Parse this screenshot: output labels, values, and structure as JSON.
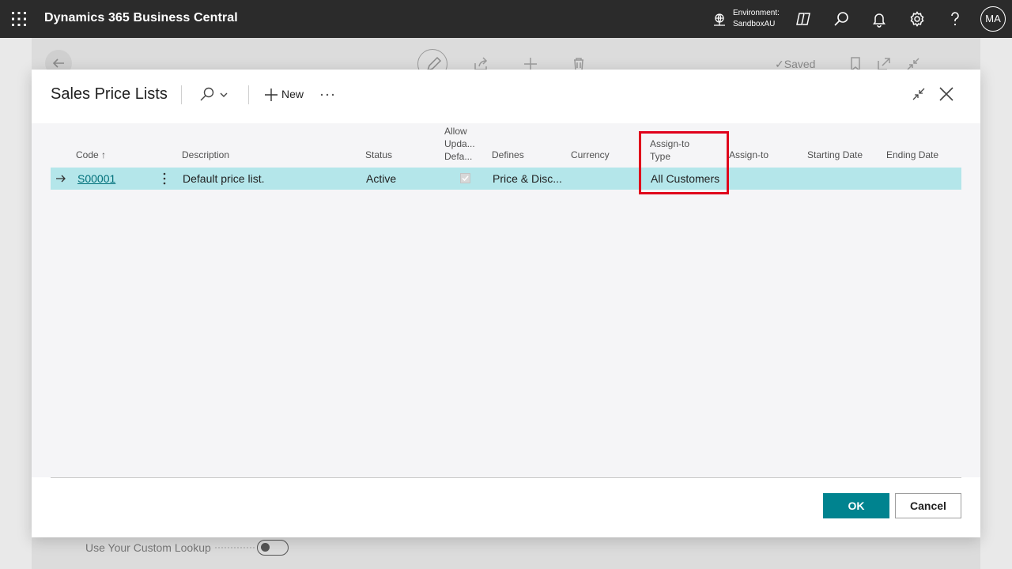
{
  "topbar": {
    "app_title": "Dynamics 365 Business Central",
    "environment_label": "Environment:",
    "environment_name": "SandboxAU",
    "avatar_initials": "MA",
    "background_color": "#2b2b2b"
  },
  "background_page": {
    "saved_label": "Saved",
    "footer_label": "Use Your Custom Lookup",
    "toggle_on": false
  },
  "dialog": {
    "title": "Sales Price Lists",
    "new_label": "New",
    "columns": {
      "code": "Code",
      "code_sort": "↑",
      "description": "Description",
      "status": "Status",
      "allow_updating_defaults": [
        "Allow",
        "Upda...",
        "Defa..."
      ],
      "defines": "Defines",
      "currency": "Currency",
      "assign_to_type": [
        "Assign-to",
        "Type"
      ],
      "assign_to": "Assign-to",
      "starting_date": "Starting Date",
      "ending_date": "Ending Date"
    },
    "rows": [
      {
        "code": "S00001",
        "description": "Default price list.",
        "status": "Active",
        "allow_updating_defaults": true,
        "defines": "Price & Disc...",
        "currency": "",
        "assign_to_type": "All Customers",
        "assign_to": "",
        "starting_date": "",
        "ending_date": ""
      }
    ],
    "ok_label": "OK",
    "cancel_label": "Cancel"
  },
  "colors": {
    "accent": "#00838f",
    "selected_row": "#b4e6ea",
    "link": "#00707a",
    "highlight_box": "#e0001b"
  }
}
